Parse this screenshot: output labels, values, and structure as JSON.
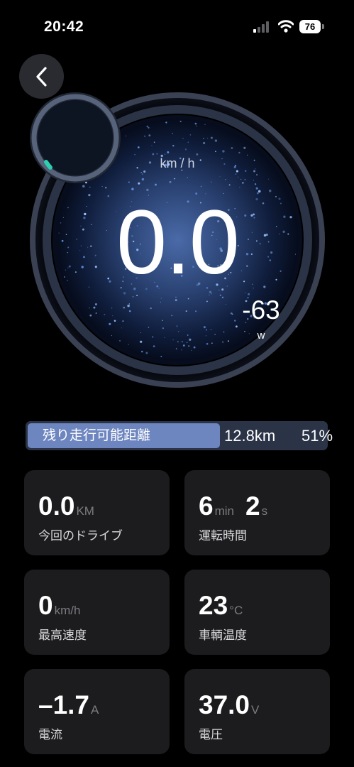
{
  "status_bar": {
    "time": "20:42",
    "battery_level": "76",
    "signal_icon": "cellular-signal-icon",
    "wifi_icon": "wifi-icon"
  },
  "nav": {
    "back_icon": "chevron-left-icon"
  },
  "speedometer": {
    "unit": "km / h",
    "speed": "0.0",
    "power_value": "-63",
    "power_unit": "w",
    "accent_color": "#2ecfb1"
  },
  "range": {
    "label": "残り走行可能距離",
    "distance": "12.8km",
    "percent": "51%",
    "fill_fraction": 0.51,
    "fill_color": "#6e86c0"
  },
  "stats": [
    {
      "value": "0.0",
      "unit": "KM",
      "label": "今回のドライブ"
    },
    {
      "value": "6",
      "unit": "min",
      "value2": "2",
      "unit2": "s",
      "label": "運転時間"
    },
    {
      "value": "0",
      "unit": "km/h",
      "label": "最高速度"
    },
    {
      "value": "23",
      "unit": "°C",
      "label": "車輌温度"
    },
    {
      "value": "–1.7",
      "unit": "A",
      "label": "電流"
    },
    {
      "value": "37.0",
      "unit": "V",
      "label": "電圧"
    }
  ]
}
